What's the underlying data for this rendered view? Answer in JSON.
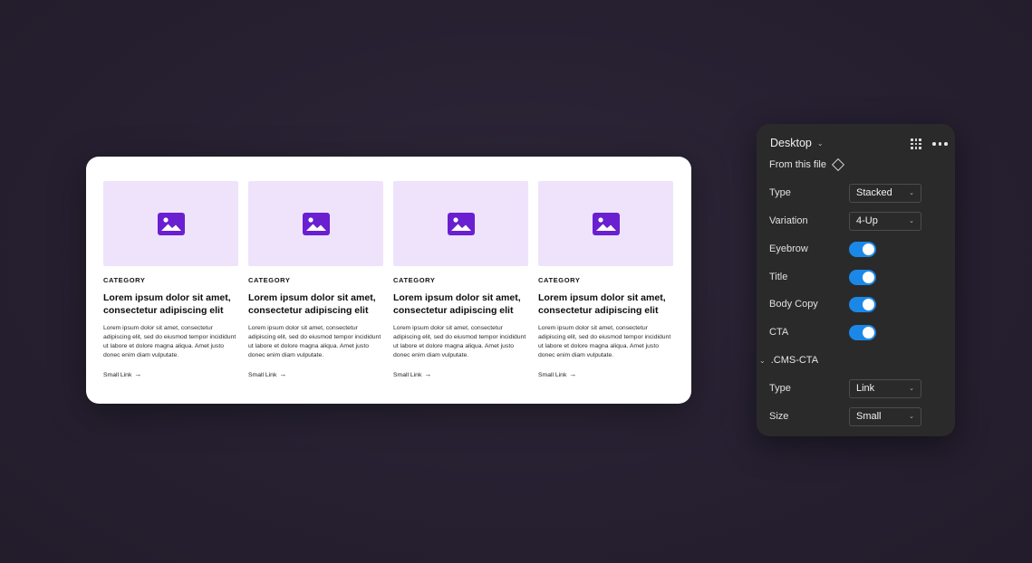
{
  "canvas": {
    "cards": [
      {
        "eyebrow": "CATEGORY",
        "title": "Lorem ipsum dolor sit amet, consectetur adipiscing elit",
        "body": "Lorem ipsum dolor sit amet, consectetur adipiscing elit, sed do eiusmod tempor incididunt ut labore et dolore magna aliqua. Amet justo donec enim diam vulputate.",
        "link": "Small Link",
        "image_icon": "image-icon"
      },
      {
        "eyebrow": "CATEGORY",
        "title": "Lorem ipsum dolor sit amet, consectetur adipiscing elit",
        "body": "Lorem ipsum dolor sit amet, consectetur adipiscing elit, sed do eiusmod tempor incididunt ut labore et dolore magna aliqua. Amet justo donec enim diam vulputate.",
        "link": "Small Link",
        "image_icon": "image-icon"
      },
      {
        "eyebrow": "CATEGORY",
        "title": "Lorem ipsum dolor sit amet, consectetur adipiscing elit",
        "body": "Lorem ipsum dolor sit amet, consectetur adipiscing elit, sed do eiusmod tempor incididunt ut labore et dolore magna aliqua. Amet justo donec enim diam vulputate.",
        "link": "Small Link",
        "image_icon": "image-icon"
      },
      {
        "eyebrow": "CATEGORY",
        "title": "Lorem ipsum dolor sit amet, consectetur adipiscing elit",
        "body": "Lorem ipsum dolor sit amet, consectetur adipiscing elit, sed do eiusmod tempor incididunt ut labore et dolore magna aliqua. Amet justo donec enim diam vulputate.",
        "link": "Small Link",
        "image_icon": "image-icon"
      }
    ]
  },
  "panel": {
    "title": "Desktop",
    "source": "From this file",
    "props": [
      {
        "label": "Type",
        "kind": "select",
        "value": "Stacked"
      },
      {
        "label": "Variation",
        "kind": "select",
        "value": "4-Up"
      },
      {
        "label": "Eyebrow",
        "kind": "toggle",
        "on": true
      },
      {
        "label": "Title",
        "kind": "toggle",
        "on": true
      },
      {
        "label": "Body Copy",
        "kind": "toggle",
        "on": true
      },
      {
        "label": "CTA",
        "kind": "toggle",
        "on": true
      }
    ],
    "section": {
      "title": ".CMS-CTA",
      "props": [
        {
          "label": "Type",
          "kind": "select",
          "value": "Link"
        },
        {
          "label": "Size",
          "kind": "select",
          "value": "Small"
        }
      ]
    }
  },
  "colors": {
    "accent_purple": "#6a1fd0",
    "thumb_bg": "#eee3fb",
    "toggle_on": "#1b88e8",
    "panel_bg": "#2a2a2a",
    "stage_bg": "#272030"
  }
}
